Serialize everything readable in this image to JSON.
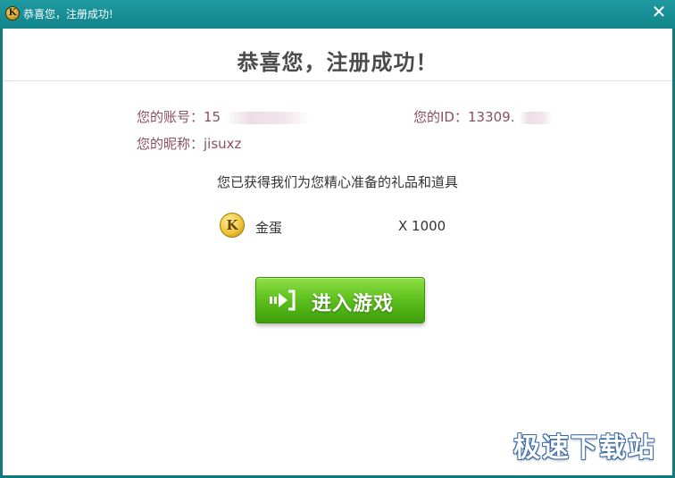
{
  "window": {
    "title": "恭喜您，注册成功!",
    "close_glyph": "✕"
  },
  "main": {
    "heading": "恭喜您，注册成功！",
    "account_label": "您的账号：",
    "account_value": "15",
    "id_label": "您的ID：",
    "id_value": "13309.",
    "nickname_label": "您的昵称：",
    "nickname_value": "jisuxz",
    "gift_intro": "您已获得我们为您精心准备的礼品和道具",
    "gift": {
      "name": "金蛋",
      "quantity": "X 1000",
      "icon_letter": "K"
    },
    "enter_button": "进入游戏"
  },
  "title_icon_letter": "K",
  "watermark": "极速下载站",
  "colors": {
    "titlebar": "#11858a",
    "info_text": "#8a4e66",
    "button_green": "#5cbf1c"
  }
}
